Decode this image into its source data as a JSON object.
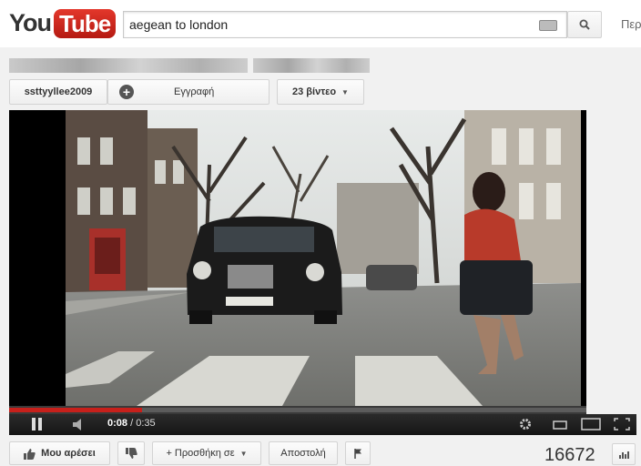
{
  "header": {
    "logo_you": "You",
    "logo_tube": "Tube",
    "search_query": "aegean to london",
    "right_link": "Περ"
  },
  "channel": {
    "name": "ssttyyllee2009",
    "subscribe_label": "Εγγραφή",
    "videos_label": "23 βίντεο"
  },
  "player": {
    "current_time": "0:08",
    "duration": "/ 0:35",
    "progress_fraction": 0.23,
    "accent": "#c7201b"
  },
  "actions": {
    "like_label": "Μου αρέσει",
    "add_label": "+ Προσθήκη σε",
    "share_label": "Αποστολή"
  },
  "views": {
    "count": "16672"
  }
}
